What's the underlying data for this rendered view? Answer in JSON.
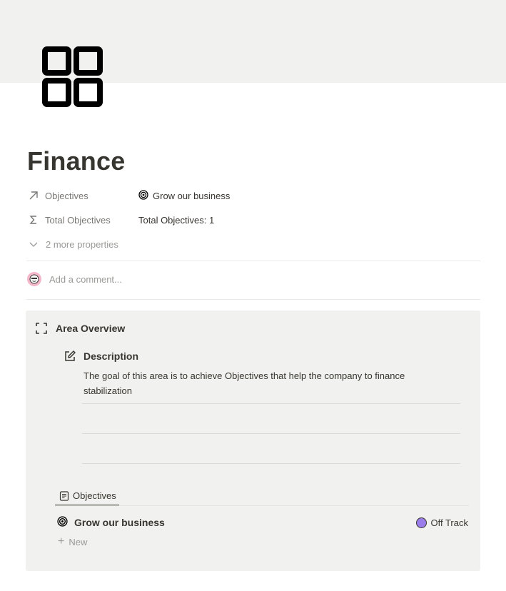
{
  "page": {
    "title": "Finance",
    "icon": "grid-icon"
  },
  "properties": [
    {
      "name": "Objectives",
      "icon": "arrow-up-right-icon",
      "value": "Grow our business",
      "value_icon": "target-icon"
    },
    {
      "name": "Total Objectives",
      "icon": "sigma-icon",
      "value": "Total Objectives: 1"
    }
  ],
  "more_properties": {
    "label": "2 more properties",
    "icon": "chevron-down-icon"
  },
  "comment": {
    "placeholder": "Add a comment..."
  },
  "panel": {
    "heading": "Area Overview",
    "heading_icon": "frame-icon",
    "description": {
      "heading": "Description",
      "heading_icon": "edit-icon",
      "text": "The goal of this area is to achieve Objectives that help the company to finance stabilization"
    },
    "tab": {
      "label": "Objectives",
      "icon": "document-icon"
    },
    "rows": [
      {
        "name": "Grow our business",
        "icon": "target-icon",
        "status": "Off Track",
        "status_color": "#9a7de8"
      }
    ],
    "new_label": "New"
  },
  "colors": {
    "cover": "#f1f1ef",
    "panel": "#f1f1ef",
    "text": "#37352f",
    "muted": "#9b9a97",
    "status_off_track": "#9a7de8"
  }
}
